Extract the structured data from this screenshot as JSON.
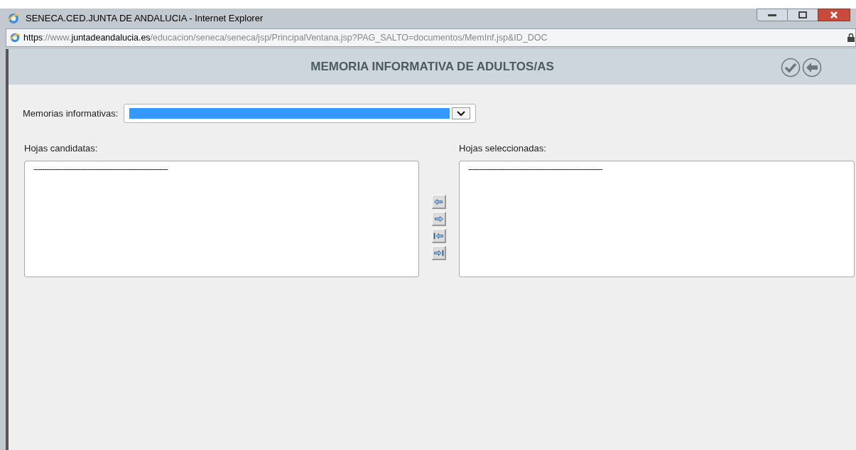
{
  "window": {
    "title": "SENECA.CED.JUNTA DE ANDALUCIA - Internet Explorer"
  },
  "address_bar": {
    "scheme": "https",
    "separator": "://www.",
    "domain": "juntadeandalucia.es",
    "path": "/educacion/seneca/seneca/jsp/PrincipalVentana.jsp?PAG_SALTO=documentos/MemInf.jsp&ID_DOC"
  },
  "header": {
    "title": "MEMORIA INFORMATIVA DE ADULTOS/AS",
    "actions": [
      {
        "kind": "accept"
      },
      {
        "kind": "back"
      }
    ]
  },
  "dropdown": {
    "label": "Memorias informativas:",
    "highlighted": true
  },
  "candidates": {
    "label": "Hojas candidatas:",
    "options": [
      "---------------------------------------------------------------"
    ]
  },
  "transfer_buttons": [
    {
      "kind": "left"
    },
    {
      "kind": "right"
    },
    {
      "kind": "all_left"
    },
    {
      "kind": "all_right"
    }
  ],
  "selected": {
    "label": "Hojas seleccionadas:",
    "options": [
      "---------------------------------------------------------------"
    ]
  }
}
